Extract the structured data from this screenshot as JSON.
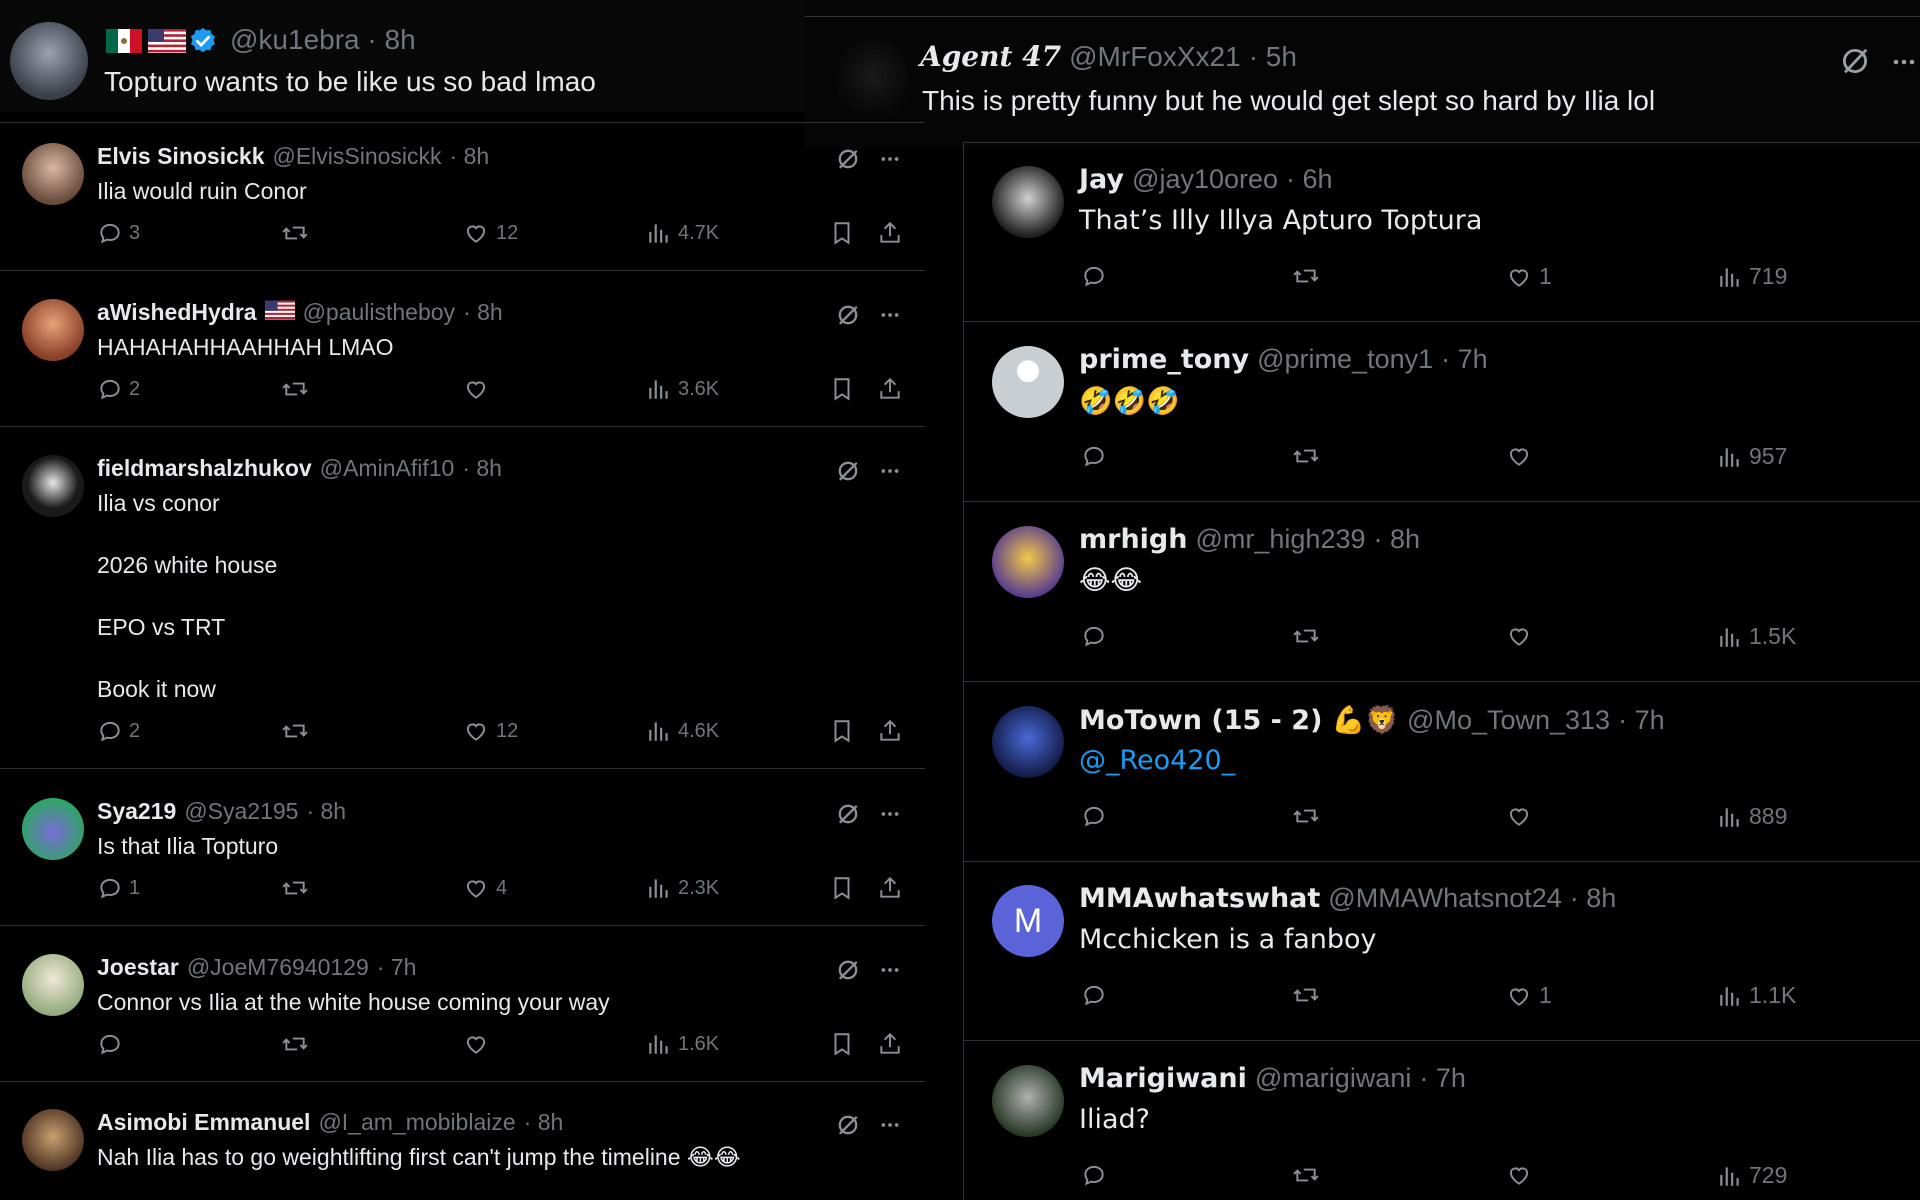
{
  "top_left": {
    "handle": "@ku1ebra",
    "time": "· 8h",
    "text": "Topturo wants to be like us so bad lmao"
  },
  "top_right": {
    "name": "Agent 47",
    "handle": "@MrFoxXx21",
    "time": "· 5h",
    "text": "This is pretty funny but he would get slept so hard by Ilia lol"
  },
  "left_replies": [
    {
      "name": "Elvis Sinosickk",
      "handle": "@ElvisSinosickk",
      "time": "· 8h",
      "lines": [
        "Ilia would ruin Conor"
      ],
      "replies": "3",
      "likes": "12",
      "views": "4.7K"
    },
    {
      "name": "aWishedHydra",
      "handle": "@paulistheboy",
      "time": "· 8h",
      "lines": [
        "HAHAHAHHAAHHAH LMAO"
      ],
      "replies": "2",
      "likes": "",
      "views": "3.6K"
    },
    {
      "name": "fieldmarshalzhukov",
      "handle": "@AminAfif10",
      "time": "· 8h",
      "lines": [
        "Ilia vs conor",
        "2026 white house",
        "EPO vs TRT",
        "Book it now"
      ],
      "replies": "2",
      "likes": "12",
      "views": "4.6K"
    },
    {
      "name": "Sya219",
      "handle": "@Sya2195",
      "time": "· 8h",
      "lines": [
        "Is that Ilia Topturo"
      ],
      "replies": "1",
      "likes": "4",
      "views": "2.3K"
    },
    {
      "name": "Joestar",
      "handle": "@JoeM76940129",
      "time": "· 7h",
      "lines": [
        "Connor vs Ilia at the white house coming your way"
      ],
      "replies": "",
      "likes": "",
      "views": "1.6K"
    },
    {
      "name": "Asimobi Emmanuel",
      "handle": "@I_am_mobiblaize",
      "time": "· 8h",
      "lines": [
        "Nah Ilia has to go weightlifting first can't jump the timeline 😂😂"
      ],
      "replies": "",
      "likes": "",
      "views": ""
    }
  ],
  "right_replies": [
    {
      "name": "Jay",
      "handle": "@jay10oreo",
      "time": "· 6h",
      "text": "That’s Illy Illya Apturo Toptura",
      "likes": "1",
      "views": "719"
    },
    {
      "name": "prime_tony",
      "handle": "@prime_tony1",
      "time": "· 7h",
      "text": "🤣🤣🤣",
      "likes": "",
      "views": "957"
    },
    {
      "name": "mrhigh",
      "handle": "@mr_high239",
      "time": "· 8h",
      "text": "😂😂",
      "likes": "",
      "views": "1.5K"
    },
    {
      "name": "MoTown (15 - 2) 💪🦁",
      "handle": "@Mo_Town_313",
      "time": "· 7h",
      "text": "@_Reo420_",
      "likes": "",
      "views": "889"
    },
    {
      "name": "MMAwhatswhat",
      "handle": "@MMAWhatsnot24",
      "time": "· 8h",
      "text": "Mcchicken is a fanboy",
      "likes": "1",
      "views": "1.1K",
      "avatar_letter": "M"
    },
    {
      "name": "Marigiwani",
      "handle": "@marigiwani",
      "time": "· 7h",
      "text": "Iliad?",
      "likes": "",
      "views": "729"
    }
  ],
  "colors": {
    "bg": "#000000",
    "text": "#e7e9ea",
    "muted": "#71767b",
    "divider": "#2f3336",
    "link": "#1d9bf0",
    "verified": "#1d9bf0",
    "grok_icon": "#9aa0a6"
  },
  "icons": [
    "reply-icon",
    "retweet-icon",
    "like-icon",
    "views-icon",
    "bookmark-icon",
    "share-icon",
    "grok-icon",
    "more-icon",
    "verified-icon"
  ]
}
